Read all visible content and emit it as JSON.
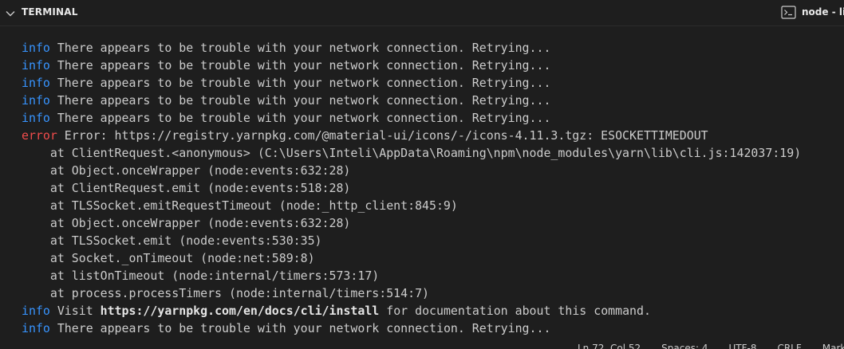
{
  "panel": {
    "title": "TERMINAL",
    "terminal_tab_label": "node - lib"
  },
  "terminal": {
    "lines": [
      {
        "level": "info",
        "text": " There appears to be trouble with your network connection. Retrying..."
      },
      {
        "level": "info",
        "text": " There appears to be trouble with your network connection. Retrying..."
      },
      {
        "level": "info",
        "text": " There appears to be trouble with your network connection. Retrying..."
      },
      {
        "level": "info",
        "text": " There appears to be trouble with your network connection. Retrying..."
      },
      {
        "level": "info",
        "text": " There appears to be trouble with your network connection. Retrying..."
      },
      {
        "level": "error",
        "text": " Error: https://registry.yarnpkg.com/@material-ui/icons/-/icons-4.11.3.tgz: ESOCKETTIMEDOUT"
      },
      {
        "level": "",
        "text": "    at ClientRequest.<anonymous> (C:\\Users\\Inteli\\AppData\\Roaming\\npm\\node_modules\\yarn\\lib\\cli.js:142037:19)"
      },
      {
        "level": "",
        "text": "    at Object.onceWrapper (node:events:632:28)"
      },
      {
        "level": "",
        "text": "    at ClientRequest.emit (node:events:518:28)"
      },
      {
        "level": "",
        "text": "    at TLSSocket.emitRequestTimeout (node:_http_client:845:9)"
      },
      {
        "level": "",
        "text": "    at Object.onceWrapper (node:events:632:28)"
      },
      {
        "level": "",
        "text": "    at TLSSocket.emit (node:events:530:35)"
      },
      {
        "level": "",
        "text": "    at Socket._onTimeout (node:net:589:8)"
      },
      {
        "level": "",
        "text": "    at listOnTimeout (node:internal/timers:573:17)"
      },
      {
        "level": "",
        "text": "    at process.processTimers (node:internal/timers:514:7)"
      },
      {
        "level": "info",
        "text": " Visit ",
        "bold": "https://yarnpkg.com/en/docs/cli/install",
        "after": " for documentation about this command."
      },
      {
        "level": "info",
        "text": " There appears to be trouble with your network connection. Retrying..."
      }
    ]
  },
  "status_bar": {
    "position": "Ln 72, Col 52",
    "spaces": "Spaces: 4",
    "encoding": "UTF-8",
    "eol": "CRLF",
    "language": "Markdown"
  },
  "colors": {
    "background": "#1e1e1e",
    "info": "#3794ff",
    "error": "#f14c4c",
    "text": "#cccccc"
  },
  "icons": {
    "collapse": "chevron-down-icon",
    "terminal": "terminal-icon"
  }
}
